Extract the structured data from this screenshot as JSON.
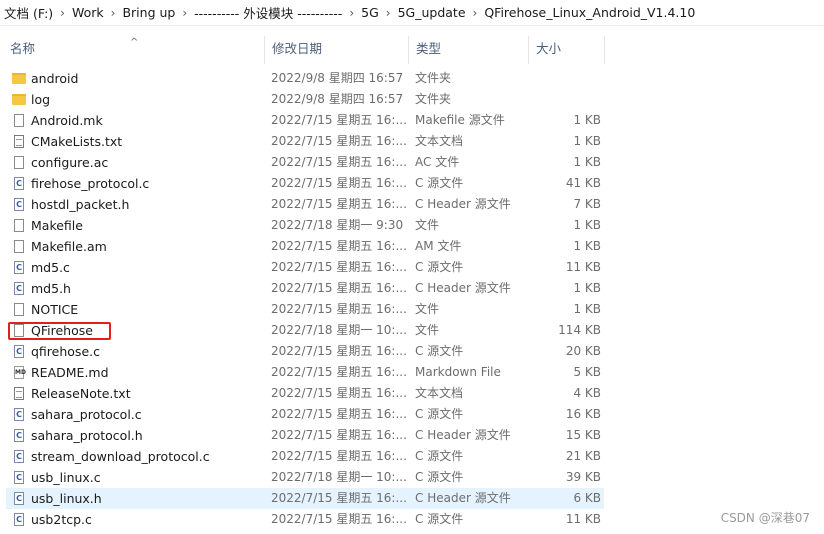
{
  "breadcrumb": [
    "文档 (F:)",
    "Work",
    "Bring up",
    "---------- 外设模块 ----------",
    "5G",
    "5G_update",
    "QFirehose_Linux_Android_V1.4.10"
  ],
  "breadcrumb_separator": "›",
  "columns": {
    "name": "名称",
    "date": "修改日期",
    "type": "类型",
    "size": "大小",
    "sort_indicator": "^"
  },
  "files": [
    {
      "icon": "folder-icon",
      "name": "android",
      "date": "2022/9/8 星期四 16:57",
      "type": "文件夹",
      "size": ""
    },
    {
      "icon": "folder-icon",
      "name": "log",
      "date": "2022/9/8 星期四 16:57",
      "type": "文件夹",
      "size": ""
    },
    {
      "icon": "file-icon",
      "name": "Android.mk",
      "date": "2022/7/15 星期五 16:...",
      "type": "Makefile 源文件",
      "size": "1 KB"
    },
    {
      "icon": "text-file-icon",
      "name": "CMakeLists.txt",
      "date": "2022/7/15 星期五 16:...",
      "type": "文本文档",
      "size": "1 KB"
    },
    {
      "icon": "file-icon",
      "name": "configure.ac",
      "date": "2022/7/15 星期五 16:...",
      "type": "AC 文件",
      "size": "1 KB"
    },
    {
      "icon": "c-file-icon",
      "name": "firehose_protocol.c",
      "date": "2022/7/15 星期五 16:...",
      "type": "C 源文件",
      "size": "41 KB"
    },
    {
      "icon": "c-file-icon",
      "name": "hostdl_packet.h",
      "date": "2022/7/15 星期五 16:...",
      "type": "C Header 源文件",
      "size": "7 KB"
    },
    {
      "icon": "file-icon",
      "name": "Makefile",
      "date": "2022/7/18 星期一 9:30",
      "type": "文件",
      "size": "1 KB"
    },
    {
      "icon": "file-icon",
      "name": "Makefile.am",
      "date": "2022/7/15 星期五 16:...",
      "type": "AM 文件",
      "size": "1 KB"
    },
    {
      "icon": "c-file-icon",
      "name": "md5.c",
      "date": "2022/7/15 星期五 16:...",
      "type": "C 源文件",
      "size": "11 KB"
    },
    {
      "icon": "c-file-icon",
      "name": "md5.h",
      "date": "2022/7/15 星期五 16:...",
      "type": "C Header 源文件",
      "size": "1 KB"
    },
    {
      "icon": "file-icon",
      "name": "NOTICE",
      "date": "2022/7/15 星期五 16:...",
      "type": "文件",
      "size": "1 KB"
    },
    {
      "icon": "file-icon",
      "name": "QFirehose",
      "date": "2022/7/18 星期一 10:...",
      "type": "文件",
      "size": "114 KB"
    },
    {
      "icon": "c-file-icon",
      "name": "qfirehose.c",
      "date": "2022/7/15 星期五 16:...",
      "type": "C 源文件",
      "size": "20 KB"
    },
    {
      "icon": "markdown-file-icon",
      "name": "README.md",
      "date": "2022/7/15 星期五 16:...",
      "type": "Markdown File",
      "size": "5 KB"
    },
    {
      "icon": "text-file-icon",
      "name": "ReleaseNote.txt",
      "date": "2022/7/15 星期五 16:...",
      "type": "文本文档",
      "size": "4 KB"
    },
    {
      "icon": "c-file-icon",
      "name": "sahara_protocol.c",
      "date": "2022/7/15 星期五 16:...",
      "type": "C 源文件",
      "size": "16 KB"
    },
    {
      "icon": "c-file-icon",
      "name": "sahara_protocol.h",
      "date": "2022/7/15 星期五 16:...",
      "type": "C Header 源文件",
      "size": "15 KB"
    },
    {
      "icon": "c-file-icon",
      "name": "stream_download_protocol.c",
      "date": "2022/7/15 星期五 16:...",
      "type": "C 源文件",
      "size": "21 KB"
    },
    {
      "icon": "c-file-icon",
      "name": "usb_linux.c",
      "date": "2022/7/18 星期一 10:...",
      "type": "C 源文件",
      "size": "39 KB"
    },
    {
      "icon": "c-file-icon",
      "name": "usb_linux.h",
      "date": "2022/7/15 星期五 16:...",
      "type": "C Header 源文件",
      "size": "6 KB",
      "selected": true
    },
    {
      "icon": "c-file-icon",
      "name": "usb2tcp.c",
      "date": "2022/7/15 星期五 16:...",
      "type": "C 源文件",
      "size": "11 KB"
    }
  ],
  "watermark": "CSDN @深巷07",
  "colors": {
    "selection": "#e5f3ff",
    "highlight_box": "#e02020",
    "folder": "#f5c842",
    "header_text": "#4c607a"
  }
}
